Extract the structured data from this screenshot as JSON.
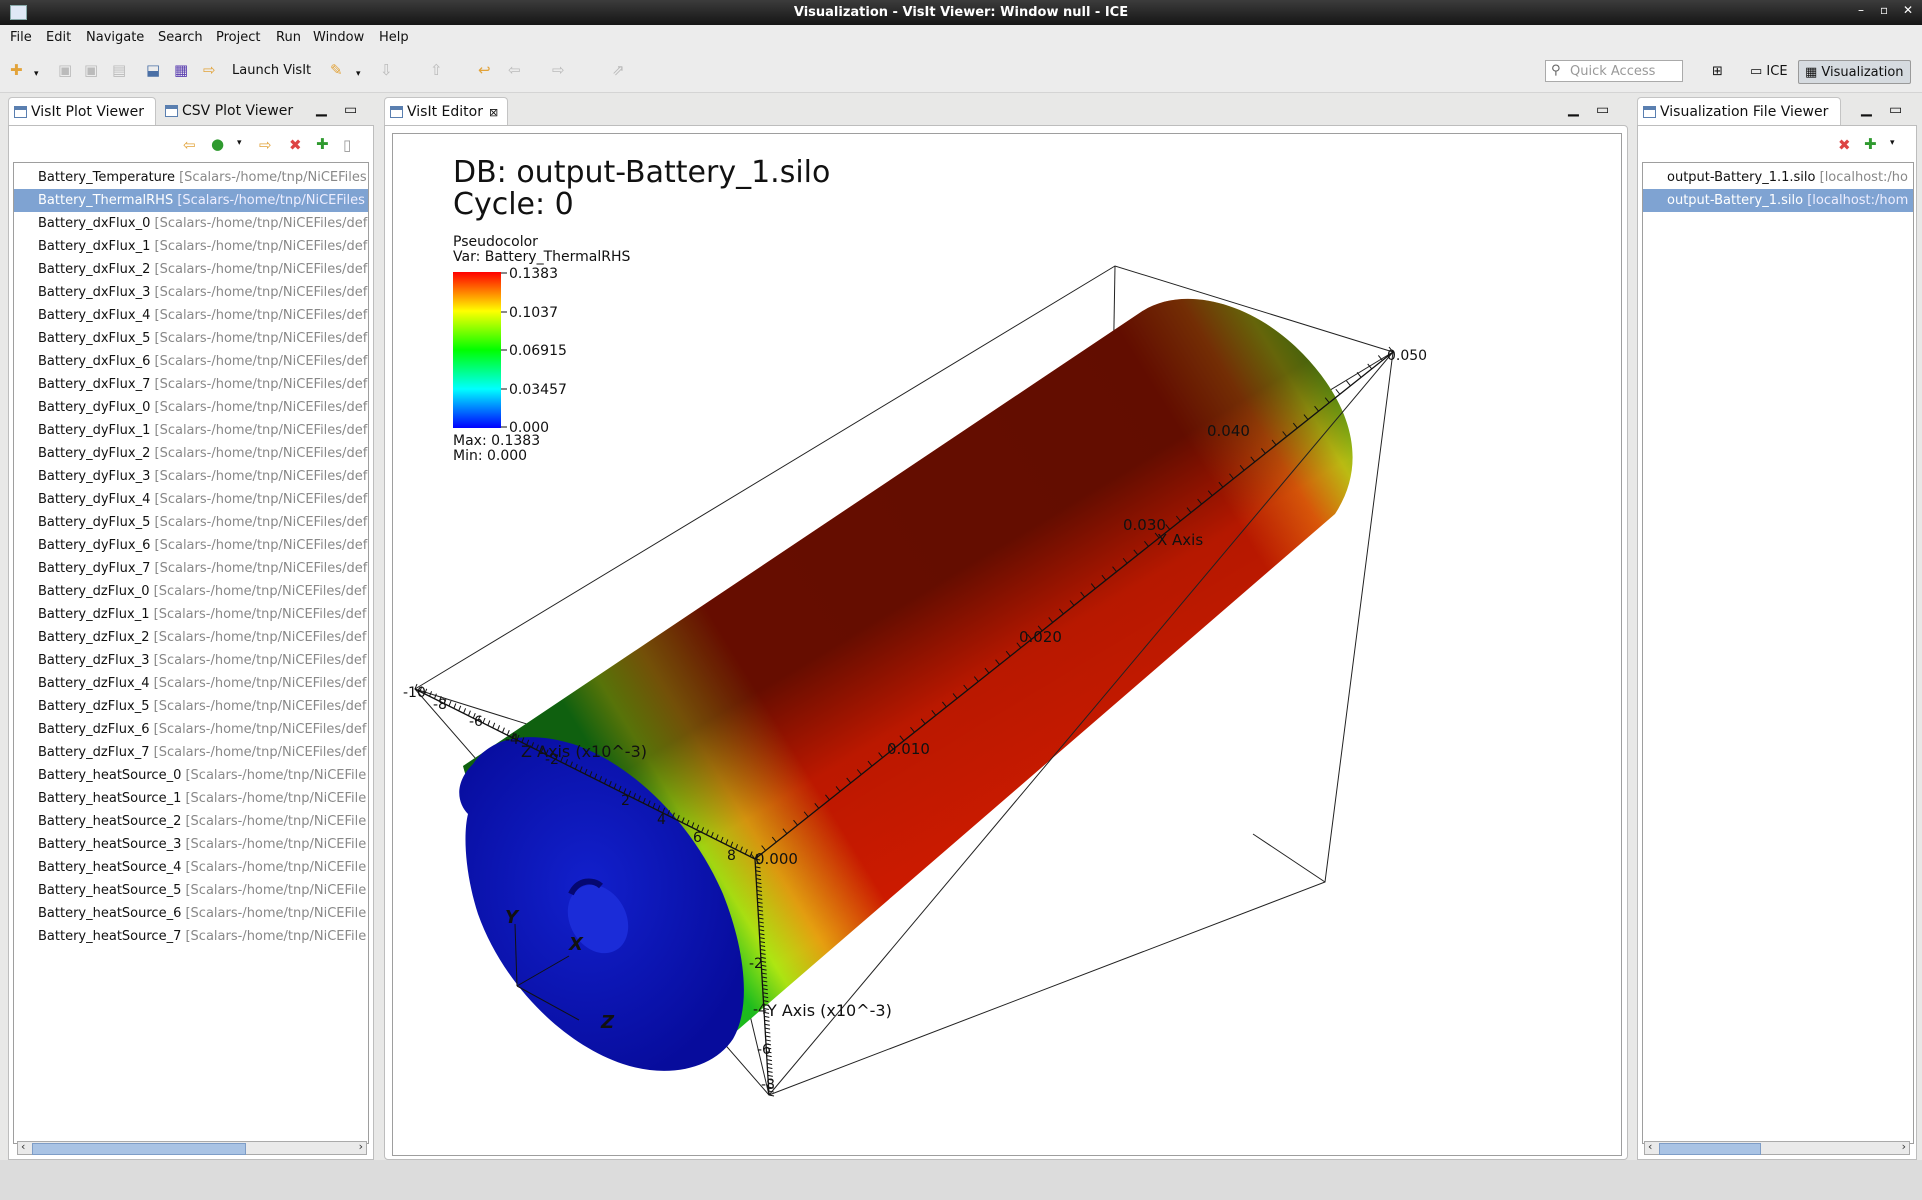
{
  "window": {
    "title": "Visualization - VisIt Viewer: Window null - ICE",
    "controls": [
      "–",
      "▫",
      "✕"
    ]
  },
  "menu": [
    "File",
    "Edit",
    "Navigate",
    "Search",
    "Project",
    "Run",
    "Window",
    "Help"
  ],
  "toolbar": {
    "launch_label": "Launch VisIt",
    "quick_access_placeholder": "Quick Access",
    "perspectives": [
      "ICE",
      "Visualization"
    ]
  },
  "left_panel": {
    "tabs": [
      "VisIt Plot Viewer",
      "CSV Plot Viewer"
    ],
    "items": [
      {
        "name": "Battery_Temperature",
        "path": "[Scalars-/home/tnp/NiCEFiles"
      },
      {
        "name": "Battery_ThermalRHS",
        "path": "[Scalars-/home/tnp/NiCEFiles"
      },
      {
        "name": "Battery_dxFlux_0",
        "path": "[Scalars-/home/tnp/NiCEFiles/def"
      },
      {
        "name": "Battery_dxFlux_1",
        "path": "[Scalars-/home/tnp/NiCEFiles/def"
      },
      {
        "name": "Battery_dxFlux_2",
        "path": "[Scalars-/home/tnp/NiCEFiles/def"
      },
      {
        "name": "Battery_dxFlux_3",
        "path": "[Scalars-/home/tnp/NiCEFiles/def"
      },
      {
        "name": "Battery_dxFlux_4",
        "path": "[Scalars-/home/tnp/NiCEFiles/def"
      },
      {
        "name": "Battery_dxFlux_5",
        "path": "[Scalars-/home/tnp/NiCEFiles/def"
      },
      {
        "name": "Battery_dxFlux_6",
        "path": "[Scalars-/home/tnp/NiCEFiles/def"
      },
      {
        "name": "Battery_dxFlux_7",
        "path": "[Scalars-/home/tnp/NiCEFiles/def"
      },
      {
        "name": "Battery_dyFlux_0",
        "path": "[Scalars-/home/tnp/NiCEFiles/def"
      },
      {
        "name": "Battery_dyFlux_1",
        "path": "[Scalars-/home/tnp/NiCEFiles/def"
      },
      {
        "name": "Battery_dyFlux_2",
        "path": "[Scalars-/home/tnp/NiCEFiles/def"
      },
      {
        "name": "Battery_dyFlux_3",
        "path": "[Scalars-/home/tnp/NiCEFiles/def"
      },
      {
        "name": "Battery_dyFlux_4",
        "path": "[Scalars-/home/tnp/NiCEFiles/def"
      },
      {
        "name": "Battery_dyFlux_5",
        "path": "[Scalars-/home/tnp/NiCEFiles/def"
      },
      {
        "name": "Battery_dyFlux_6",
        "path": "[Scalars-/home/tnp/NiCEFiles/def"
      },
      {
        "name": "Battery_dyFlux_7",
        "path": "[Scalars-/home/tnp/NiCEFiles/def"
      },
      {
        "name": "Battery_dzFlux_0",
        "path": "[Scalars-/home/tnp/NiCEFiles/def"
      },
      {
        "name": "Battery_dzFlux_1",
        "path": "[Scalars-/home/tnp/NiCEFiles/def"
      },
      {
        "name": "Battery_dzFlux_2",
        "path": "[Scalars-/home/tnp/NiCEFiles/def"
      },
      {
        "name": "Battery_dzFlux_3",
        "path": "[Scalars-/home/tnp/NiCEFiles/def"
      },
      {
        "name": "Battery_dzFlux_4",
        "path": "[Scalars-/home/tnp/NiCEFiles/def"
      },
      {
        "name": "Battery_dzFlux_5",
        "path": "[Scalars-/home/tnp/NiCEFiles/def"
      },
      {
        "name": "Battery_dzFlux_6",
        "path": "[Scalars-/home/tnp/NiCEFiles/def"
      },
      {
        "name": "Battery_dzFlux_7",
        "path": "[Scalars-/home/tnp/NiCEFiles/def"
      },
      {
        "name": "Battery_heatSource_0",
        "path": "[Scalars-/home/tnp/NiCEFile"
      },
      {
        "name": "Battery_heatSource_1",
        "path": "[Scalars-/home/tnp/NiCEFile"
      },
      {
        "name": "Battery_heatSource_2",
        "path": "[Scalars-/home/tnp/NiCEFile"
      },
      {
        "name": "Battery_heatSource_3",
        "path": "[Scalars-/home/tnp/NiCEFile"
      },
      {
        "name": "Battery_heatSource_4",
        "path": "[Scalars-/home/tnp/NiCEFile"
      },
      {
        "name": "Battery_heatSource_5",
        "path": "[Scalars-/home/tnp/NiCEFile"
      },
      {
        "name": "Battery_heatSource_6",
        "path": "[Scalars-/home/tnp/NiCEFile"
      },
      {
        "name": "Battery_heatSource_7",
        "path": "[Scalars-/home/tnp/NiCEFile"
      }
    ],
    "selected_index": 1
  },
  "editor": {
    "tab": "VisIt Editor",
    "db_title": "DB: output-Battery_1.silo",
    "cycle": "Cycle: 0",
    "plot_type": "Pseudocolor",
    "var": "Var: Battery_ThermalRHS",
    "legend_ticks": [
      "0.1383",
      "0.1037",
      "0.06915",
      "0.03457",
      "0.000"
    ],
    "max_label": "Max:  0.1383",
    "min_label": "Min:  0.000",
    "x_axis_label": "X Axis",
    "z_axis_label": "Z Axis (x10^-3)",
    "y_axis_label": "Y Axis (x10^-3)",
    "x_ticks": [
      "0.000",
      "0.010",
      "0.020",
      "0.030",
      "0.040",
      "0.050"
    ],
    "z_ticks": [
      "-10",
      "-8",
      "-6",
      "-4",
      "-2",
      "2",
      "4",
      "6",
      "8"
    ],
    "y_ticks": [
      "-2",
      "-4",
      "-6",
      "-8"
    ],
    "triad": [
      "Y",
      "X",
      "Z"
    ]
  },
  "right_panel": {
    "tab": "Visualization File Viewer",
    "items": [
      {
        "name": "output-Battery_1.1.silo",
        "path": "[localhost:/ho"
      },
      {
        "name": "output-Battery_1.silo",
        "path": "[localhost:/hom"
      }
    ],
    "selected_index": 1
  },
  "colors": {
    "selection": "#7fa3d2",
    "titlebar": "#222222",
    "cylinder_hot": "#cc1a00",
    "cylinder_cap": "#0a10b8"
  }
}
